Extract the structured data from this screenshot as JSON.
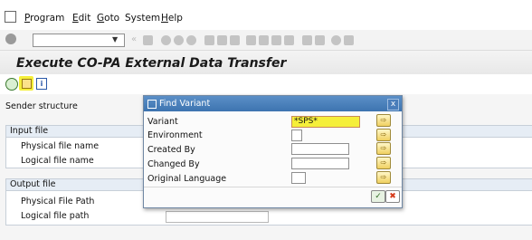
{
  "menu": {
    "items": [
      {
        "label": "Program",
        "underline": "P",
        "rest": "rogram"
      },
      {
        "label": "Edit",
        "underline": "E",
        "rest": "dit"
      },
      {
        "label": "Goto",
        "underline": "G",
        "rest": "oto"
      },
      {
        "label": "System",
        "underline": "",
        "rest": "System"
      },
      {
        "label": "Help",
        "underline": "H",
        "rest": "elp"
      }
    ]
  },
  "screen": {
    "title": "Execute CO-PA External Data Transfer"
  },
  "content": {
    "sender_structure_label": "Sender structure",
    "input_group": {
      "title": "Input file",
      "physical_label": "Physical file name",
      "logical_label": "Logical file name"
    },
    "output_group": {
      "title": "Output file",
      "physical_label": "Physical File Path",
      "logical_label": "Logical file path"
    }
  },
  "dialog": {
    "title": "Find Variant",
    "close_glyph": "x",
    "fields": [
      {
        "label": "Variant",
        "value": "*SPS*"
      },
      {
        "label": "Environment",
        "value": ""
      },
      {
        "label": "Created By",
        "value": ""
      },
      {
        "label": "Changed By",
        "value": ""
      },
      {
        "label": "Original Language",
        "value": ""
      }
    ]
  },
  "colors": {
    "accent": "#3d74b0",
    "highlight": "#f5ef3a",
    "cancel_red": "#d53a1a"
  }
}
